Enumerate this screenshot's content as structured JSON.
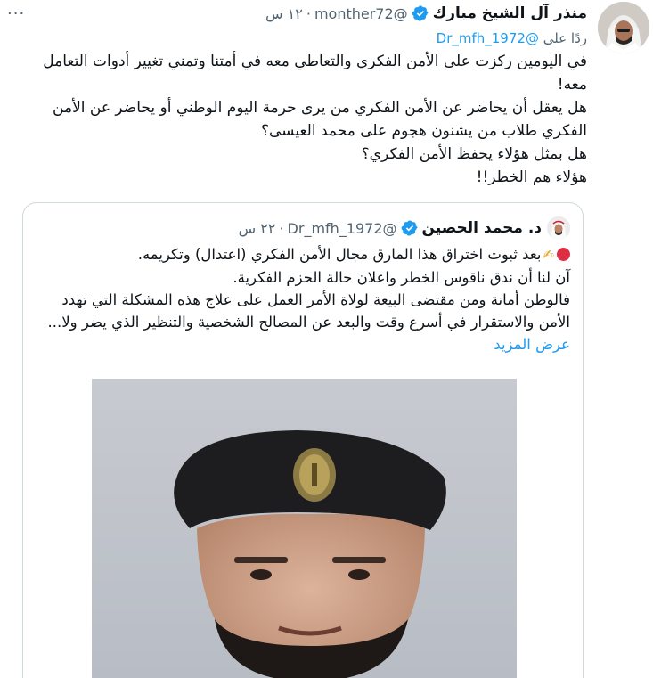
{
  "tweet": {
    "author_name": "منذر آل الشيخ مبارك",
    "handle": "@monther72",
    "separator": "·",
    "time": "١٢ س",
    "more_label": "···",
    "reply_prefix": "ردًا على",
    "reply_handle": "@Dr_mfh_1972",
    "lines": [
      "في اليومين ركزت على الأمن الفكري والتعاطي معه في أمتنا وتمني تغيير أدوات التعامل معه!",
      "هل يعقل أن يحاضر عن الأمن الفكري من يرى حرمة اليوم الوطني أو يحاضر عن الأمن الفكري طلاب من يشنون هجوم على محمد العيسى؟",
      "هل بمثل هؤلاء يحفظ الأمن الفكري؟",
      "هؤلاء هم الخطر!!"
    ]
  },
  "quoted": {
    "author_name": "د. محمد الحصين",
    "handle": "@Dr_mfh_1972",
    "separator": "·",
    "time": "٢٢ س",
    "lines": [
      "بعد ثبوت اختراق هذا المارق مجال الأمن الفكري (اعتدال) وتكريمه.",
      "آن لنا أن ندق ناقوس الخطر واعلان حالة الحزم الفكرية.",
      "فالوطن أمانة ومن مقتضى البيعة لولاة الأمر العمل على علاج هذه المشكلة التي تهدد الأمن والاستقرار في أسرع وقت والبعد عن المصالح الشخصية والتنظير الذي يضر ولا..."
    ],
    "show_more": "عرض المزيد"
  },
  "icons": {
    "verified": "verified-badge-icon",
    "more": "more-options-icon",
    "red_circle": "red-circle-emoji",
    "writing_hand": "writing-hand-emoji"
  },
  "colors": {
    "accent": "#1d9bf0",
    "secondary_text": "#536471",
    "border": "#cfd9de",
    "emoji_red": "#dd2e44"
  }
}
